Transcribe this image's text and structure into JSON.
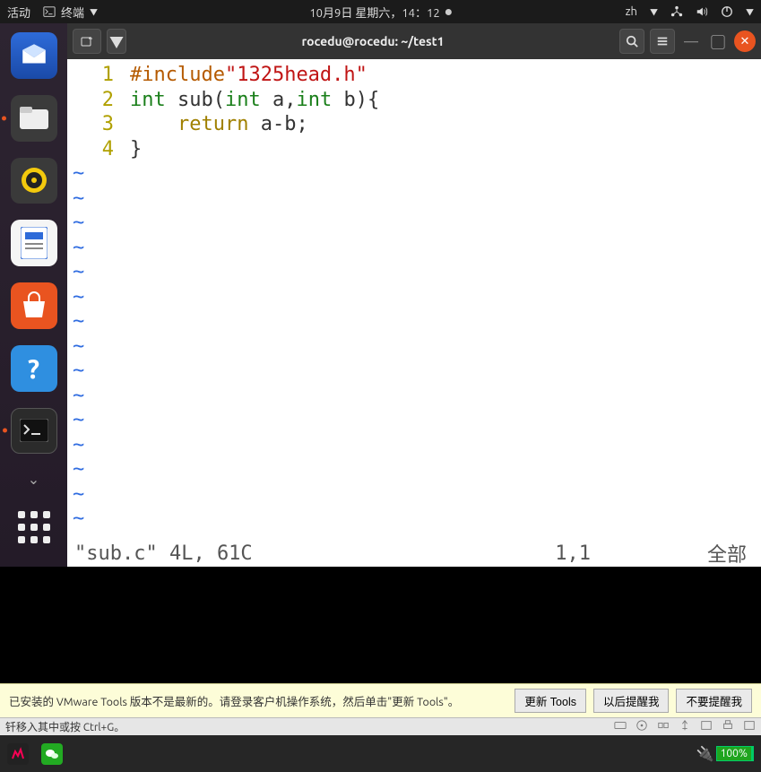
{
  "topbar": {
    "activities": "活动",
    "app_name": "终端",
    "datetime": "10月9日 星期六，14：12",
    "input_method": "zh"
  },
  "dock": {
    "tooltip": "帮助"
  },
  "terminal": {
    "title": "rocedu@rocedu: ~/test1",
    "code": {
      "line1": {
        "pp": "#include",
        "str": "\"1325head.h\""
      },
      "line2": {
        "t1": "int",
        "id1": " sub(",
        "t2": "int",
        "id2": " a,",
        "t3": "int",
        "id3": " b){"
      },
      "line3": {
        "kw": "return",
        "rest": " a-b;"
      },
      "line4": "}"
    },
    "line_numbers": [
      "1",
      "2",
      "3",
      "4"
    ],
    "status": {
      "file": "\"sub.c\" 4L, 61C",
      "pos": "1,1",
      "all": "全部"
    }
  },
  "vmware": {
    "msg": "已安装的 VMware Tools 版本不是最新的。请登录客户机操作系统，然后单击\"更新 Tools\"。",
    "btn_update": "更新 Tools",
    "btn_later": "以后提醒我",
    "btn_never": "不要提醒我",
    "hint": "钎移入其中或按 Ctrl+G。",
    "battery": "100%"
  }
}
